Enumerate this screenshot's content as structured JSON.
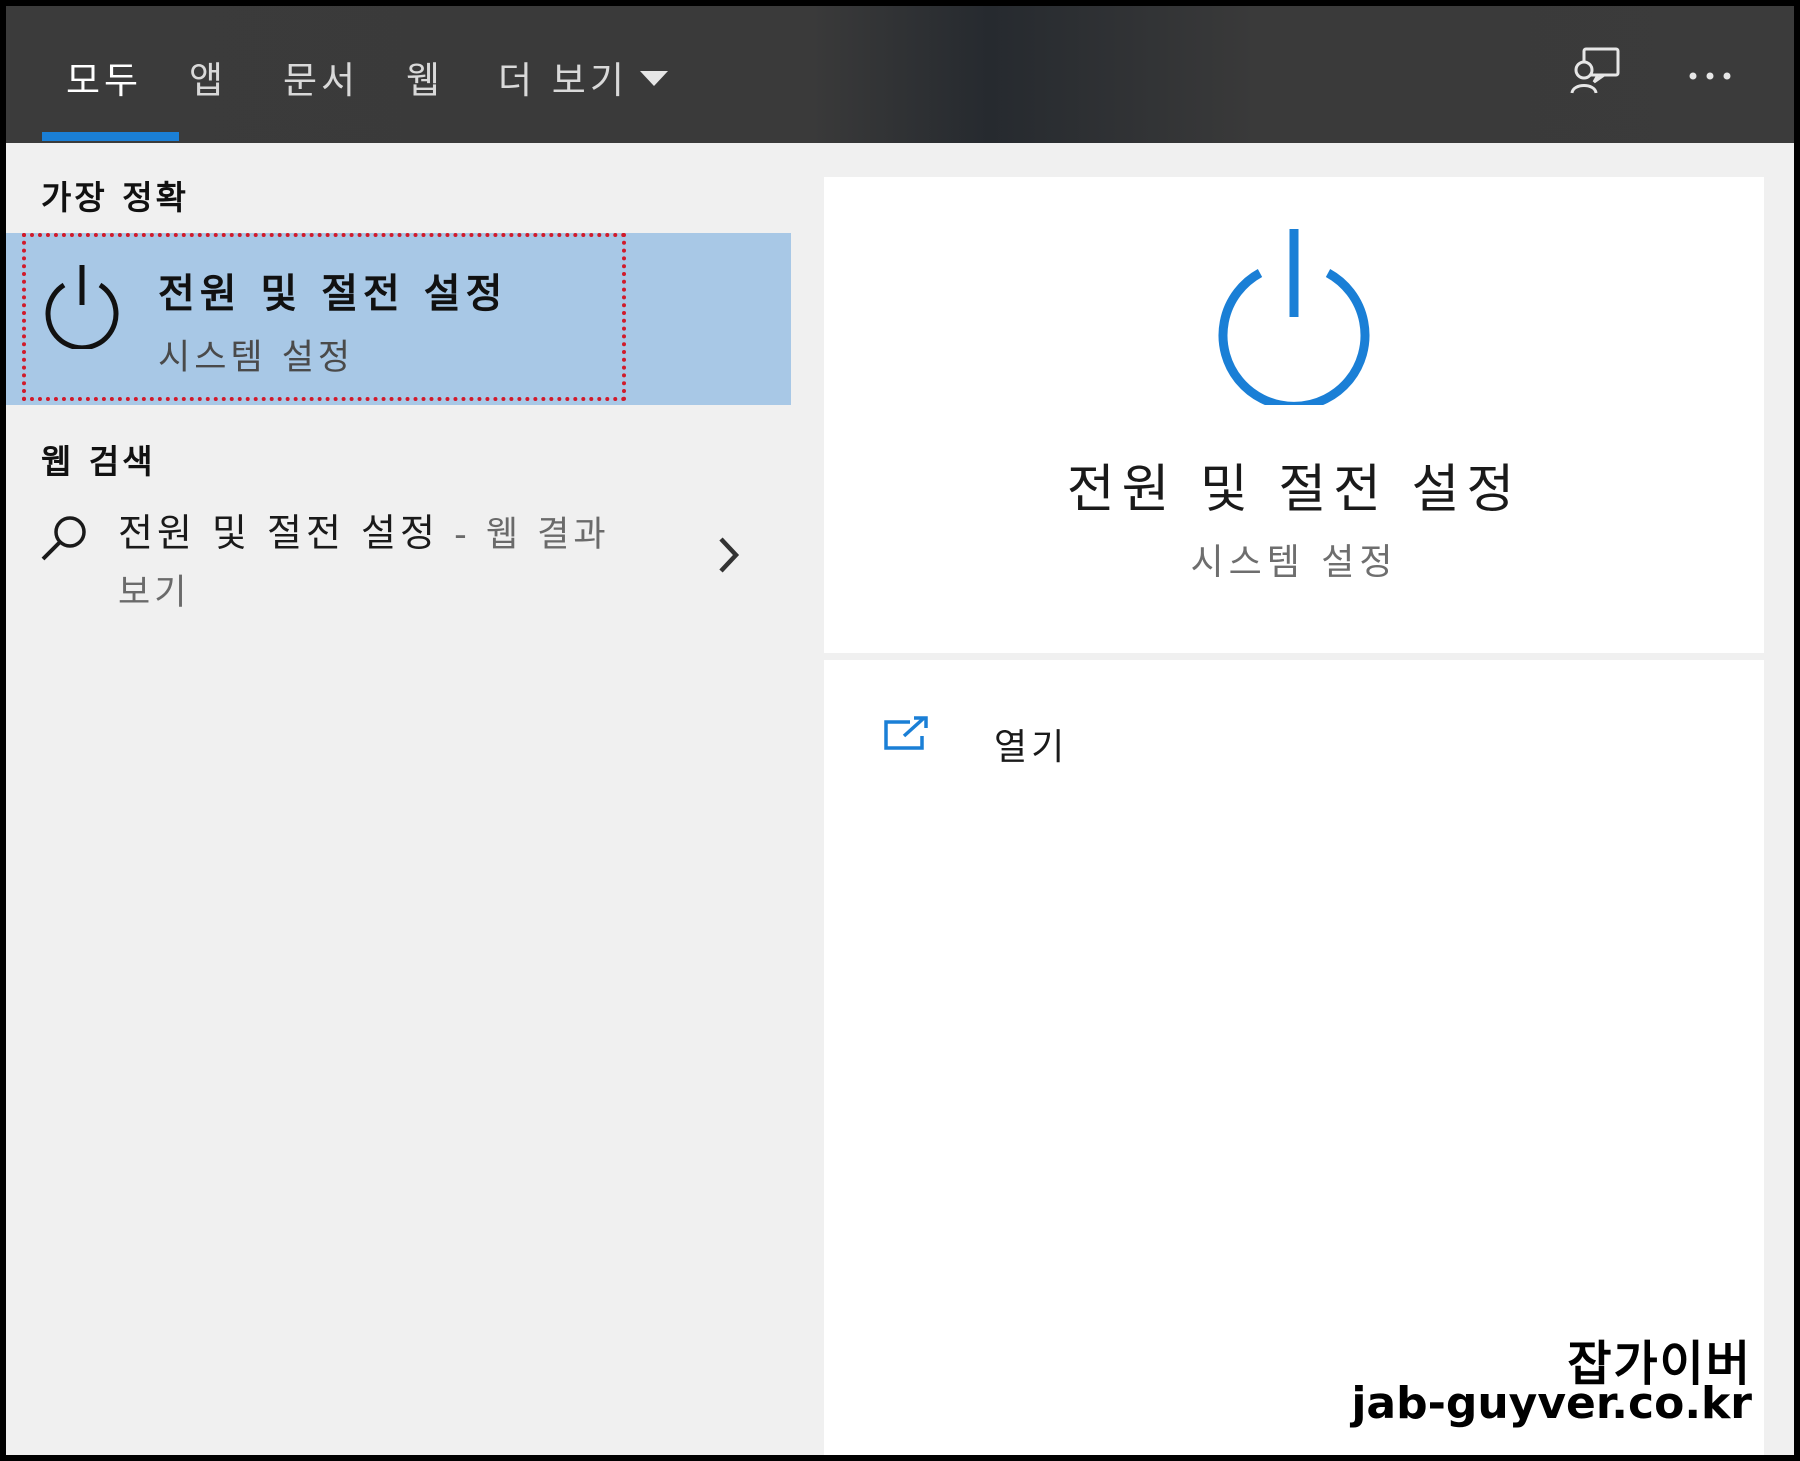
{
  "tabs": {
    "all": "모두",
    "apps": "앱",
    "documents": "문서",
    "web": "웹",
    "more": "더 보기"
  },
  "best_match": {
    "heading": "가장 정확",
    "title": "전원 및 절전 설정",
    "subtitle": "시스템 설정"
  },
  "web_search": {
    "heading": "웹 검색",
    "query": "전원 및 절전 설정",
    "suffix": " - 웹 결과 보기"
  },
  "preview": {
    "title": "전원 및 절전 설정",
    "subtitle": "시스템 설정",
    "open_label": "열기"
  },
  "watermark": {
    "line1": "잡가이버",
    "line2": "jab-guyver.co.kr"
  },
  "colors": {
    "accent": "#1a7fd6",
    "selection": "#a8c8e6",
    "highlight_border": "#d11a2a",
    "topbar": "#3b3b3b"
  }
}
